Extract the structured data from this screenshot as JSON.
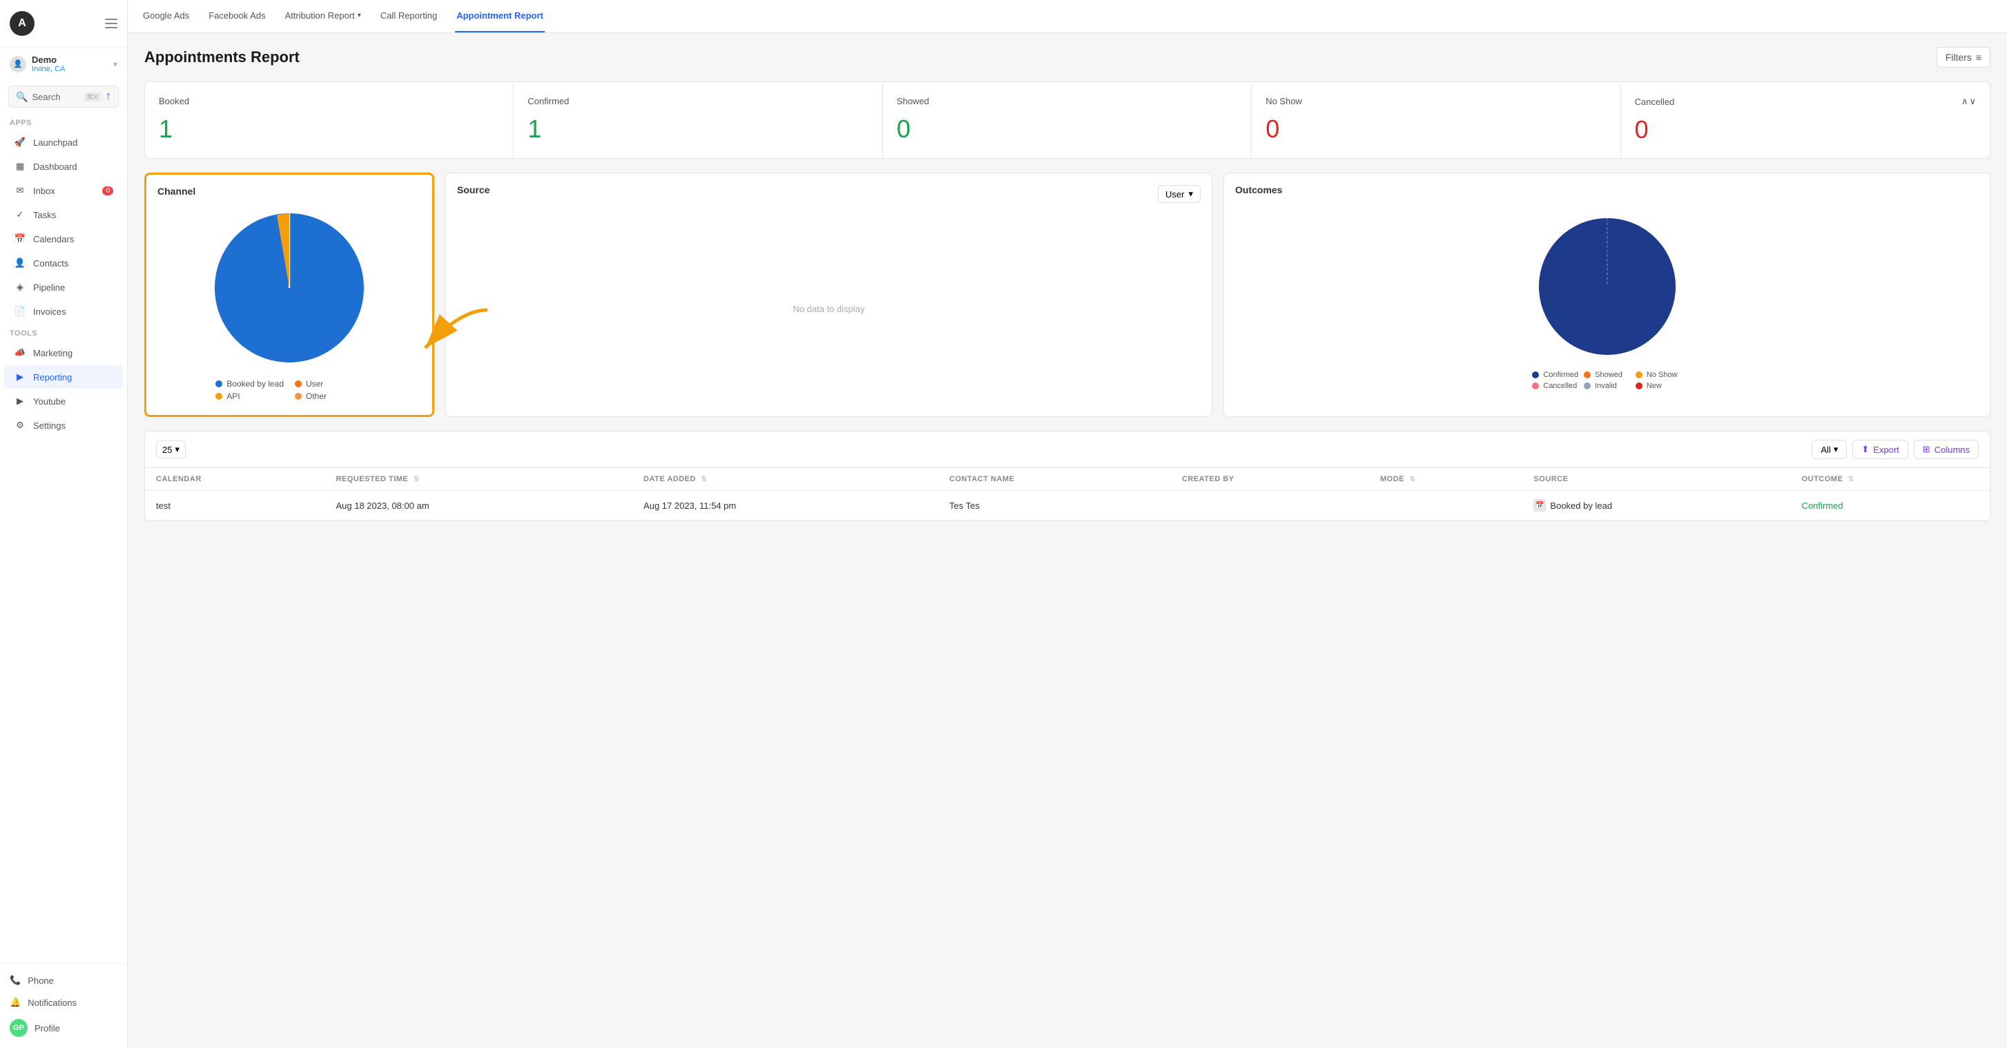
{
  "app": {
    "logo_letter": "A",
    "account": {
      "name": "Demo",
      "location": "Irvine, CA"
    }
  },
  "sidebar": {
    "search_label": "Search",
    "search_shortcut": "⌘K",
    "apps_section": "Apps",
    "tools_section": "Tools",
    "nav_items": [
      {
        "id": "launchpad",
        "label": "Launchpad",
        "icon": "🚀"
      },
      {
        "id": "dashboard",
        "label": "Dashboard",
        "icon": "▦"
      },
      {
        "id": "inbox",
        "label": "Inbox",
        "icon": "✉",
        "badge": "0"
      },
      {
        "id": "tasks",
        "label": "Tasks",
        "icon": "✓"
      },
      {
        "id": "calendars",
        "label": "Calendars",
        "icon": "📅"
      },
      {
        "id": "contacts",
        "label": "Contacts",
        "icon": "👤"
      },
      {
        "id": "pipeline",
        "label": "Pipeline",
        "icon": "◈"
      },
      {
        "id": "invoices",
        "label": "Invoices",
        "icon": "📄"
      }
    ],
    "tool_items": [
      {
        "id": "marketing",
        "label": "Marketing",
        "icon": "📣"
      },
      {
        "id": "reporting",
        "label": "Reporting",
        "icon": "▶",
        "active": true
      },
      {
        "id": "youtube",
        "label": "Youtube",
        "icon": "▶"
      },
      {
        "id": "settings",
        "label": "Settings",
        "icon": "⚙"
      }
    ],
    "footer_items": [
      {
        "id": "phone",
        "label": "Phone",
        "icon": "📞"
      },
      {
        "id": "notifications",
        "label": "Notifications",
        "icon": "🔔"
      },
      {
        "id": "profile",
        "label": "Profile",
        "avatar": "GP"
      }
    ]
  },
  "topnav": {
    "tabs": [
      {
        "id": "google-ads",
        "label": "Google Ads"
      },
      {
        "id": "facebook-ads",
        "label": "Facebook Ads"
      },
      {
        "id": "attribution-report",
        "label": "Attribution Report",
        "has_arrow": true
      },
      {
        "id": "call-reporting",
        "label": "Call Reporting"
      },
      {
        "id": "appointment-report",
        "label": "Appointment Report",
        "active": true
      }
    ]
  },
  "page": {
    "title": "Appointments Report",
    "filters_label": "Filters"
  },
  "stats": [
    {
      "id": "booked",
      "label": "Booked",
      "value": "1",
      "color": "green"
    },
    {
      "id": "confirmed",
      "label": "Confirmed",
      "value": "1",
      "color": "green"
    },
    {
      "id": "showed",
      "label": "Showed",
      "value": "0",
      "color": "green"
    },
    {
      "id": "no-show",
      "label": "No Show",
      "value": "0",
      "color": "red"
    },
    {
      "id": "cancelled",
      "label": "Cancelled",
      "value": "0",
      "color": "red",
      "has_chevrons": true
    }
  ],
  "charts": {
    "channel": {
      "title": "Channel",
      "highlighted": true,
      "pie_data": [
        {
          "label": "Booked by lead",
          "color": "#1d6fd1",
          "value": 95
        },
        {
          "label": "API",
          "color": "#f59e0b",
          "value": 5
        }
      ],
      "legend": [
        {
          "label": "Booked by lead",
          "color": "#1d6fd1"
        },
        {
          "label": "API",
          "color": "#f59e0b"
        },
        {
          "label": "User",
          "color": "#f97316"
        },
        {
          "label": "Other",
          "color": "#fb923c"
        }
      ]
    },
    "source": {
      "title": "Source",
      "dropdown_label": "User",
      "no_data": "No data to display"
    },
    "outcomes": {
      "title": "Outcomes",
      "pie_data": [
        {
          "label": "Confirmed",
          "color": "#1e3a8a",
          "value": 100
        }
      ],
      "legend": [
        {
          "label": "Confirmed",
          "color": "#1e3a8a"
        },
        {
          "label": "Showed",
          "color": "#f97316"
        },
        {
          "label": "No Show",
          "color": "#f59e0b"
        },
        {
          "label": "Cancelled",
          "color": "#fb7185"
        },
        {
          "label": "Invalid",
          "color": "#94a3b8"
        },
        {
          "label": "New",
          "color": "#dc2626"
        }
      ]
    }
  },
  "table": {
    "page_size": "25",
    "filter_label": "All",
    "export_label": "Export",
    "columns_label": "Columns",
    "columns": [
      {
        "id": "calendar",
        "label": "Calendar",
        "sortable": false
      },
      {
        "id": "requested-time",
        "label": "Requested Time",
        "sortable": true
      },
      {
        "id": "date-added",
        "label": "Date Added",
        "sortable": true
      },
      {
        "id": "contact-name",
        "label": "Contact Name",
        "sortable": false
      },
      {
        "id": "created-by",
        "label": "Created By",
        "sortable": false
      },
      {
        "id": "mode",
        "label": "Mode",
        "sortable": true
      },
      {
        "id": "source",
        "label": "Source",
        "sortable": false
      },
      {
        "id": "outcome",
        "label": "Outcome",
        "sortable": true
      }
    ],
    "rows": [
      {
        "calendar": "test",
        "requested_time": "Aug 18 2023, 08:00 am",
        "date_added": "Aug 17 2023, 11:54 pm",
        "contact_name": "Tes Tes",
        "created_by": "",
        "mode": "",
        "source": "Booked by lead",
        "source_has_icon": true,
        "outcome": "Confirmed"
      }
    ]
  },
  "annotation": {
    "arrow_color": "#f59e0b"
  }
}
